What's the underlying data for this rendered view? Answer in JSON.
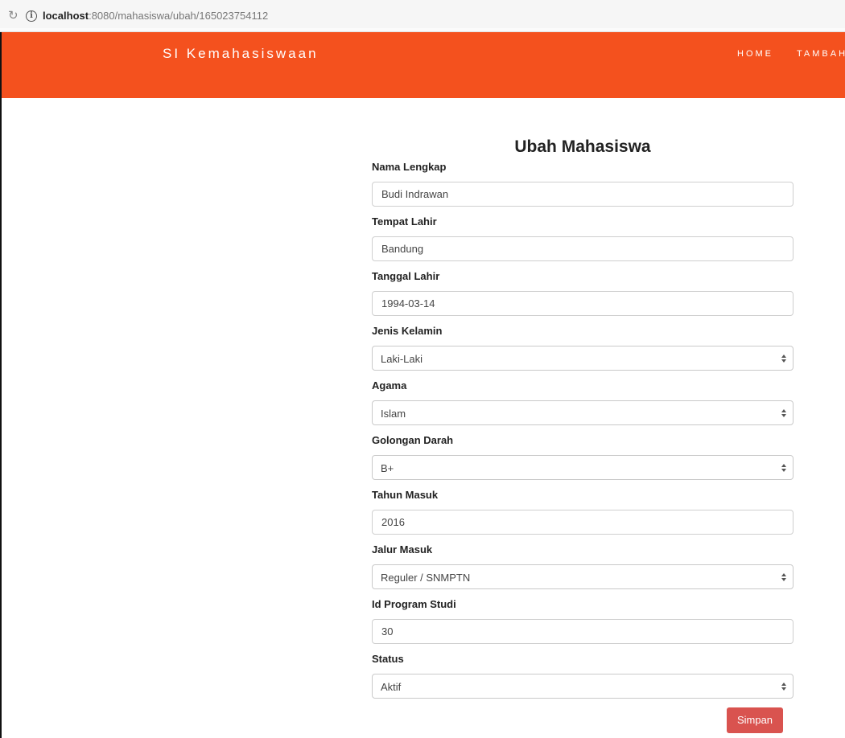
{
  "browser": {
    "url_host": "localhost",
    "url_rest": ":8080/mahasiswa/ubah/165023754112",
    "reload_icon": "reload-icon",
    "info_icon": "info-icon"
  },
  "navbar": {
    "brand": "SI Kemahasiswaan",
    "links": [
      "HOME",
      "TAMBAH"
    ],
    "background_color": "#f4511e"
  },
  "form": {
    "title": "Ubah Mahasiswa",
    "fields": [
      {
        "label": "Nama Lengkap",
        "value": "Budi Indrawan",
        "kind": "input"
      },
      {
        "label": "Tempat Lahir",
        "value": "Bandung",
        "kind": "input"
      },
      {
        "label": "Tanggal Lahir",
        "value": "1994-03-14",
        "kind": "input"
      },
      {
        "label": "Jenis Kelamin",
        "value": "Laki-Laki",
        "kind": "select"
      },
      {
        "label": "Agama",
        "value": "Islam",
        "kind": "select"
      },
      {
        "label": "Golongan Darah",
        "value": "B+",
        "kind": "select"
      },
      {
        "label": "Tahun Masuk",
        "value": "2016",
        "kind": "input"
      },
      {
        "label": "Jalur Masuk",
        "value": "Reguler / SNMPTN",
        "kind": "select"
      },
      {
        "label": "Id Program Studi",
        "value": "30",
        "kind": "input"
      },
      {
        "label": "Status",
        "value": "Aktif",
        "kind": "select"
      }
    ],
    "submit_label": "Simpan",
    "submit_color": "#d9534f"
  }
}
